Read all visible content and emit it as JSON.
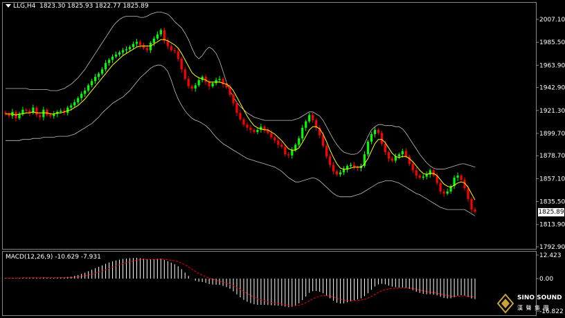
{
  "header": {
    "symbol": "LLG,H4",
    "ohlc": "1823.30 1825.93 1822.77 1825.89"
  },
  "macd_header": {
    "label": "MACD(12,26,9)",
    "values": "-10.629 -7.931"
  },
  "current_price_tag": "1825.89",
  "logo": {
    "name": "SINO SOUND",
    "cn": "漢 聲 集 團"
  },
  "colors": {
    "background": "#000000",
    "bull": "#00ff00",
    "bear": "#ff0000",
    "ma": "#ffff00",
    "bands": "#c0c0c0",
    "macd_hist": "#ffffff",
    "macd_signal": "#ff0000",
    "grid_text": "#ffffff"
  },
  "chart_data": [
    {
      "type": "candlestick",
      "title": "",
      "ylim": [
        1792.9,
        2015.0
      ],
      "y_ticks": [
        "2007.10",
        "1985.50",
        "1963.90",
        "1942.90",
        "1921.30",
        "1899.70",
        "1878.70",
        "1857.10",
        "1835.50",
        "1813.90",
        "1792.90"
      ],
      "y_tick_values": [
        2007.1,
        1985.5,
        1963.9,
        1942.9,
        1921.3,
        1899.7,
        1878.7,
        1857.1,
        1835.5,
        1813.9,
        1792.9
      ],
      "legend": "none",
      "series": [
        {
          "name": "",
          "kind": "close",
          "values": [
            1918,
            1916,
            1920,
            1914,
            1918,
            1922,
            1921,
            1919,
            1924,
            1917,
            1915,
            1922,
            1917,
            1916,
            1918,
            1920,
            1921,
            1919,
            1924,
            1926,
            1929,
            1933,
            1937,
            1940,
            1945,
            1949,
            1953,
            1956,
            1960,
            1966,
            1969,
            1972,
            1974,
            1976,
            1978,
            1979,
            1981,
            1984,
            1986,
            1983,
            1980,
            1978,
            1985,
            1989,
            1993,
            1997,
            1987,
            1982,
            1978,
            1977,
            1970,
            1960,
            1951,
            1944,
            1942,
            1945,
            1950,
            1953,
            1948,
            1944,
            1947,
            1950,
            1951,
            1946,
            1943,
            1936,
            1928,
            1919,
            1913,
            1908,
            1905,
            1903,
            1901,
            1903,
            1906,
            1903,
            1900,
            1896,
            1893,
            1889,
            1887,
            1880,
            1879,
            1884,
            1889,
            1895,
            1905,
            1911,
            1917,
            1912,
            1905,
            1898,
            1888,
            1878,
            1870,
            1864,
            1861,
            1863,
            1866,
            1869,
            1870,
            1868,
            1867,
            1869,
            1880,
            1892,
            1899,
            1903,
            1900,
            1890,
            1882,
            1876,
            1874,
            1878,
            1880,
            1883,
            1878,
            1871,
            1865,
            1860,
            1858,
            1859,
            1861,
            1865,
            1860,
            1853,
            1845,
            1843,
            1845,
            1850,
            1858,
            1860,
            1856,
            1848,
            1838,
            1828,
            1826
          ]
        },
        {
          "name": "",
          "kind": "ma",
          "values": [
            1918,
            1918,
            1918,
            1917,
            1918,
            1918,
            1919,
            1919,
            1920,
            1919,
            1919,
            1919,
            1919,
            1918,
            1918,
            1919,
            1919,
            1920,
            1921,
            1922,
            1924,
            1926,
            1929,
            1932,
            1936,
            1940,
            1944,
            1948,
            1952,
            1956,
            1960,
            1964,
            1967,
            1970,
            1973,
            1975,
            1977,
            1979,
            1981,
            1982,
            1982,
            1982,
            1982,
            1984,
            1986,
            1988,
            1988,
            1987,
            1985,
            1983,
            1980,
            1975,
            1969,
            1963,
            1957,
            1954,
            1952,
            1951,
            1950,
            1948,
            1948,
            1948,
            1948,
            1947,
            1946,
            1944,
            1940,
            1934,
            1928,
            1922,
            1916,
            1911,
            1907,
            1905,
            1904,
            1903,
            1903,
            1901,
            1899,
            1896,
            1893,
            1889,
            1885,
            1884,
            1884,
            1886,
            1891,
            1897,
            1903,
            1906,
            1906,
            1904,
            1899,
            1892,
            1884,
            1877,
            1871,
            1867,
            1866,
            1866,
            1867,
            1868,
            1868,
            1868,
            1871,
            1876,
            1883,
            1890,
            1894,
            1894,
            1891,
            1886,
            1881,
            1878,
            1877,
            1878,
            1878,
            1876,
            1873,
            1869,
            1865,
            1862,
            1861,
            1862,
            1862,
            1860,
            1856,
            1852,
            1850,
            1849,
            1851,
            1853,
            1854,
            1853,
            1849,
            1843,
            1837
          ]
        },
        {
          "name": "",
          "kind": "upper_band",
          "values": [
            1942,
            1942,
            1942,
            1942,
            1942,
            1942,
            1942,
            1941,
            1941,
            1941,
            1941,
            1941,
            1941,
            1940,
            1940,
            1940,
            1941,
            1942,
            1944,
            1946,
            1949,
            1952,
            1956,
            1960,
            1965,
            1970,
            1975,
            1980,
            1985,
            1990,
            1995,
            2000,
            2004,
            2007,
            2009,
            2010,
            2010,
            2010,
            2010,
            2009,
            2009,
            2010,
            2012,
            2013,
            2014,
            2014,
            2013,
            2012,
            2009,
            2005,
            2002,
            1999,
            1994,
            1988,
            1980,
            1973,
            1970,
            1973,
            1978,
            1981,
            1979,
            1975,
            1968,
            1958,
            1948,
            1940,
            1934,
            1929,
            1925,
            1922,
            1919,
            1917,
            1915,
            1914,
            1913,
            1912,
            1912,
            1912,
            1912,
            1912,
            1912,
            1912,
            1912,
            1912,
            1913,
            1914,
            1916,
            1918,
            1920,
            1920,
            1918,
            1916,
            1912,
            1906,
            1900,
            1894,
            1889,
            1885,
            1882,
            1881,
            1880,
            1880,
            1881,
            1884,
            1890,
            1897,
            1903,
            1906,
            1908,
            1908,
            1907,
            1907,
            1907,
            1906,
            1906,
            1904,
            1900,
            1895,
            1890,
            1885,
            1880,
            1876,
            1872,
            1869,
            1867,
            1866,
            1866,
            1866,
            1867,
            1868,
            1869,
            1870,
            1871,
            1871,
            1870,
            1869,
            1868
          ]
        },
        {
          "name": "",
          "kind": "lower_band",
          "values": [
            1893,
            1893,
            1893,
            1893,
            1893,
            1894,
            1894,
            1894,
            1895,
            1895,
            1895,
            1896,
            1896,
            1896,
            1896,
            1897,
            1897,
            1897,
            1897,
            1898,
            1899,
            1901,
            1903,
            1905,
            1907,
            1909,
            1912,
            1915,
            1919,
            1922,
            1925,
            1928,
            1930,
            1932,
            1934,
            1937,
            1940,
            1944,
            1948,
            1952,
            1955,
            1958,
            1961,
            1963,
            1964,
            1964,
            1962,
            1958,
            1950,
            1940,
            1932,
            1926,
            1921,
            1917,
            1914,
            1912,
            1911,
            1909,
            1907,
            1904,
            1900,
            1896,
            1893,
            1890,
            1888,
            1886,
            1884,
            1882,
            1880,
            1878,
            1876,
            1875,
            1874,
            1873,
            1872,
            1871,
            1870,
            1869,
            1868,
            1866,
            1864,
            1861,
            1858,
            1856,
            1854,
            1854,
            1855,
            1856,
            1857,
            1858,
            1857,
            1855,
            1852,
            1849,
            1846,
            1843,
            1841,
            1840,
            1840,
            1840,
            1840,
            1841,
            1842,
            1843,
            1845,
            1847,
            1849,
            1851,
            1853,
            1854,
            1855,
            1855,
            1855,
            1854,
            1853,
            1851,
            1849,
            1847,
            1845,
            1843,
            1842,
            1840,
            1838,
            1836,
            1834,
            1832,
            1830,
            1829,
            1828,
            1828,
            1828,
            1828,
            1828,
            1828,
            1826,
            1824,
            1822
          ]
        }
      ]
    },
    {
      "type": "bar",
      "title": "MACD(12,26,9)",
      "ylim": [
        -16.822,
        12.423
      ],
      "y_ticks": [
        "12.423",
        "0.00",
        "-16.822"
      ],
      "y_tick_values": [
        12.423,
        0.0,
        -16.822
      ],
      "legend": "none",
      "series": [
        {
          "name": "",
          "kind": "macd",
          "values": [
            0.3,
            0.3,
            0.4,
            0.3,
            0.4,
            0.5,
            0.5,
            0.5,
            0.6,
            0.5,
            0.4,
            0.6,
            0.5,
            0.4,
            0.4,
            0.5,
            0.6,
            0.6,
            0.8,
            1.0,
            1.4,
            1.9,
            2.5,
            3.1,
            3.9,
            4.7,
            5.5,
            6.2,
            7.0,
            7.8,
            8.5,
            9.1,
            9.6,
            10.0,
            10.4,
            10.6,
            10.8,
            10.9,
            11.0,
            10.8,
            10.5,
            10.2,
            10.2,
            10.3,
            10.4,
            10.5,
            9.9,
            9.2,
            8.4,
            7.6,
            6.5,
            5.0,
            3.2,
            1.4,
            -0.1,
            -1.1,
            -1.6,
            -1.8,
            -2.2,
            -2.8,
            -3.1,
            -3.2,
            -3.3,
            -3.8,
            -4.4,
            -5.3,
            -6.6,
            -8.2,
            -9.7,
            -11.0,
            -12.0,
            -12.7,
            -13.3,
            -13.6,
            -13.6,
            -13.6,
            -13.7,
            -13.8,
            -13.9,
            -14.0,
            -14.1,
            -14.5,
            -14.8,
            -14.6,
            -13.9,
            -12.8,
            -11.1,
            -9.3,
            -7.4,
            -6.5,
            -6.4,
            -6.8,
            -7.6,
            -8.8,
            -10.2,
            -11.5,
            -12.5,
            -12.9,
            -12.8,
            -12.3,
            -11.8,
            -11.2,
            -10.8,
            -10.2,
            -9.1,
            -7.6,
            -5.8,
            -4.1,
            -3.0,
            -2.7,
            -3.0,
            -3.6,
            -4.2,
            -4.5,
            -4.6,
            -4.6,
            -4.8,
            -5.3,
            -6.0,
            -6.8,
            -7.4,
            -7.9,
            -8.1,
            -8.1,
            -8.3,
            -8.7,
            -9.4,
            -10.0,
            -10.3,
            -10.2,
            -9.6,
            -8.9,
            -8.6,
            -8.8,
            -9.5,
            -10.3,
            -10.6
          ]
        },
        {
          "name": "",
          "kind": "signal",
          "values": [
            0.3,
            0.3,
            0.3,
            0.3,
            0.3,
            0.4,
            0.4,
            0.4,
            0.4,
            0.4,
            0.4,
            0.5,
            0.5,
            0.5,
            0.5,
            0.5,
            0.5,
            0.5,
            0.6,
            0.6,
            0.8,
            0.9,
            1.2,
            1.5,
            1.9,
            2.3,
            2.8,
            3.4,
            4.0,
            4.6,
            5.3,
            6.0,
            6.6,
            7.3,
            7.9,
            8.4,
            8.9,
            9.3,
            9.7,
            10.0,
            10.1,
            10.2,
            10.2,
            10.2,
            10.2,
            10.3,
            10.2,
            10.0,
            9.7,
            9.4,
            8.9,
            8.2,
            7.3,
            6.2,
            5.0,
            3.8,
            2.7,
            1.8,
            1.0,
            0.2,
            -0.4,
            -0.9,
            -1.4,
            -1.9,
            -2.4,
            -3.0,
            -3.7,
            -4.6,
            -5.6,
            -6.7,
            -7.7,
            -8.7,
            -9.6,
            -10.4,
            -11.0,
            -11.5,
            -12.0,
            -12.4,
            -12.7,
            -13.0,
            -13.2,
            -13.5,
            -13.8,
            -14.0,
            -14.0,
            -13.8,
            -13.3,
            -12.5,
            -11.5,
            -10.5,
            -9.7,
            -9.1,
            -8.8,
            -8.8,
            -9.1,
            -9.6,
            -10.2,
            -10.7,
            -11.1,
            -11.4,
            -11.5,
            -11.4,
            -11.3,
            -11.1,
            -10.7,
            -10.1,
            -9.2,
            -8.2,
            -7.2,
            -6.3,
            -5.7,
            -5.3,
            -5.1,
            -5.0,
            -4.9,
            -4.8,
            -4.8,
            -4.9,
            -5.1,
            -5.5,
            -5.9,
            -6.3,
            -6.7,
            -7.0,
            -7.3,
            -7.6,
            -8.0,
            -8.4,
            -8.8,
            -9.1,
            -9.2,
            -9.1,
            -9.0,
            -8.9,
            -9.1,
            -9.3,
            -9.5
          ]
        }
      ]
    }
  ]
}
